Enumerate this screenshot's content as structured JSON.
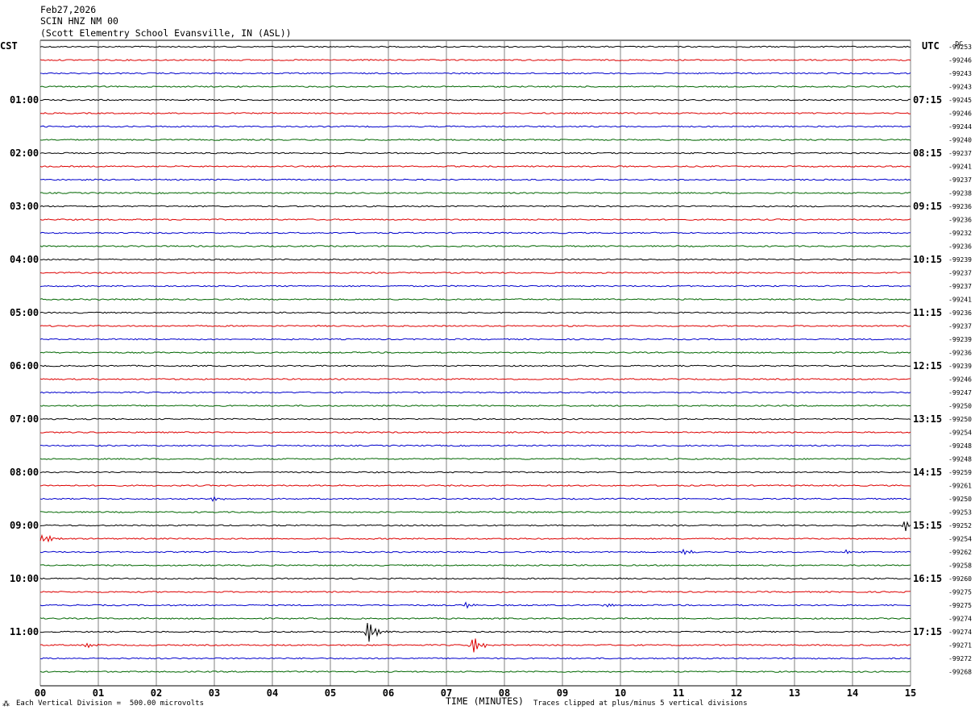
{
  "header": {
    "date": "Feb27,2026",
    "station": "SCIN HNZ NM 00",
    "location": "(Scott Elementry School Evansville, IN (ASL))"
  },
  "left_tz": "CST",
  "right_tz": "UTC",
  "dc_label": "DC",
  "footer": {
    "scale_note": "Each Vertical Division =  500.00 microvolts",
    "x_title": "TIME (MINUTES)",
    "clip_note": "Traces clipped at plus/minus 5 vertical divisions"
  },
  "colors": {
    "trace_cycle": [
      "#000000",
      "#dd0000",
      "#0000cc",
      "#006600"
    ],
    "grid": "#808080"
  },
  "chart_data": {
    "type": "line",
    "title": "",
    "xlabel": "TIME (MINUTES)",
    "ylabel": "",
    "xlim": [
      0,
      15
    ],
    "x_ticks": [
      "00",
      "01",
      "02",
      "03",
      "04",
      "05",
      "06",
      "07",
      "08",
      "09",
      "10",
      "11",
      "12",
      "13",
      "14",
      "15"
    ],
    "left_time_labels": [
      "01:00",
      "02:00",
      "03:00",
      "04:00",
      "05:00",
      "06:00",
      "07:00",
      "08:00",
      "09:00",
      "10:00",
      "11:00"
    ],
    "right_time_labels": [
      "07:15",
      "08:15",
      "09:15",
      "10:15",
      "11:15",
      "12:15",
      "13:15",
      "14:15",
      "15:15",
      "16:15",
      "17:15"
    ],
    "trace_count": 48,
    "dc_offsets": [
      "-99253",
      "-99246",
      "-99243",
      "-99243",
      "-99245",
      "-99246",
      "-99244",
      "-99240",
      "-99237",
      "-99241",
      "-99237",
      "-99238",
      "-99236",
      "-99236",
      "-99232",
      "-99236",
      "-99239",
      "-99237",
      "-99237",
      "-99241",
      "-99236",
      "-99237",
      "-99239",
      "-99236",
      "-99239",
      "-99246",
      "-99247",
      "-99250",
      "-99250",
      "-99254",
      "-99248",
      "-99248",
      "-99259",
      "-99261",
      "-99250",
      "-99253",
      "-99252",
      "-99254",
      "-99262",
      "-99258",
      "-99260",
      "-99275",
      "-99275",
      "-99274",
      "-99274",
      "-99271",
      "-99272",
      "-99268"
    ],
    "events": [
      {
        "trace": 34,
        "minute": 2.95,
        "amplitude": 0.4
      },
      {
        "trace": 36,
        "minute": 14.9,
        "amplitude": 0.8
      },
      {
        "trace": 37,
        "minute": 0.05,
        "amplitude": 0.8
      },
      {
        "trace": 38,
        "minute": 11.1,
        "amplitude": 0.4
      },
      {
        "trace": 38,
        "minute": 13.9,
        "amplitude": 0.3
      },
      {
        "trace": 42,
        "minute": 7.35,
        "amplitude": 0.4
      },
      {
        "trace": 42,
        "minute": 9.75,
        "amplitude": 0.3
      },
      {
        "trace": 44,
        "minute": 5.65,
        "amplitude": 1.6
      },
      {
        "trace": 45,
        "minute": 0.75,
        "amplitude": 0.5
      },
      {
        "trace": 45,
        "minute": 7.45,
        "amplitude": 1.4
      }
    ]
  }
}
